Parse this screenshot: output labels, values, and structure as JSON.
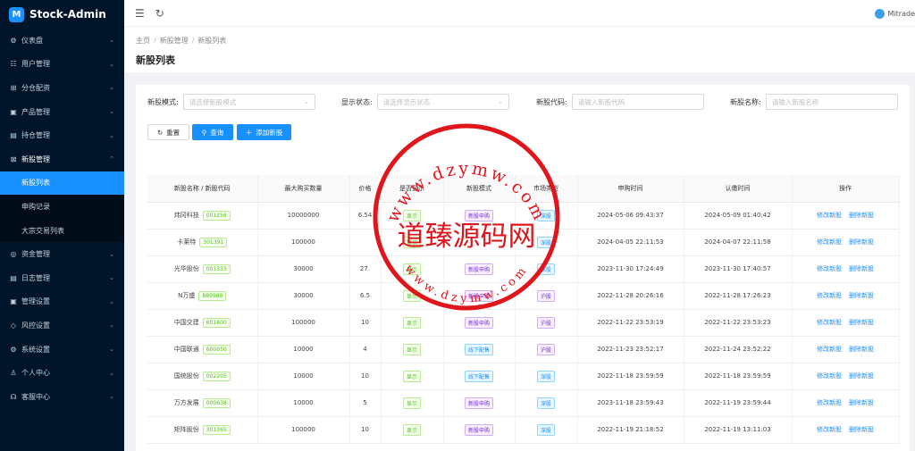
{
  "app": {
    "name": "Stock-Admin",
    "logo_glyph": "M"
  },
  "sidebar": {
    "items": [
      {
        "icon": "dashboard-icon",
        "glyph": "⚙",
        "label": "仪表盘"
      },
      {
        "icon": "user-icon",
        "glyph": "☷",
        "label": "用户管理"
      },
      {
        "icon": "split-icon",
        "glyph": "⊞",
        "label": "分仓配资"
      },
      {
        "icon": "product-icon",
        "glyph": "▣",
        "label": "产品管理"
      },
      {
        "icon": "holding-icon",
        "glyph": "▤",
        "label": "持仓管理"
      },
      {
        "icon": "ipo-icon",
        "glyph": "⊠",
        "label": "新股管理"
      }
    ],
    "sub": [
      {
        "label": "新股列表",
        "active": true
      },
      {
        "label": "申购记录"
      },
      {
        "label": "大宗交易列表"
      }
    ],
    "items2": [
      {
        "icon": "fund-icon",
        "glyph": "◎",
        "label": "资金管理"
      },
      {
        "icon": "log-icon",
        "glyph": "▤",
        "label": "日志管理"
      },
      {
        "icon": "admin-icon",
        "glyph": "▣",
        "label": "管理设置"
      },
      {
        "icon": "risk-icon",
        "glyph": "◇",
        "label": "风控设置"
      },
      {
        "icon": "settings-icon",
        "glyph": "⚙",
        "label": "系统设置"
      },
      {
        "icon": "profile-icon",
        "glyph": "♙",
        "label": "个人中心"
      },
      {
        "icon": "service-icon",
        "glyph": "☊",
        "label": "客服中心"
      }
    ]
  },
  "topbar": {
    "user": "Mitrade"
  },
  "breadcrumb": [
    "主页",
    "新股管理",
    "新股列表"
  ],
  "page_title": "新股列表",
  "filters": [
    {
      "label": "新股模式:",
      "placeholder": "请选择新股模式",
      "dropdown": true
    },
    {
      "label": "显示状态:",
      "placeholder": "请选择显示状态",
      "dropdown": true
    },
    {
      "label": "新股代码:",
      "placeholder": "请输入新股代码",
      "dropdown": false
    },
    {
      "label": "新股名称:",
      "placeholder": "请输入新股名称",
      "dropdown": false
    }
  ],
  "buttons": {
    "reset": "重置",
    "query": "查询",
    "add": "添加新股"
  },
  "table": {
    "headers": [
      "新股名称 / 新股代码",
      "最大购买数量",
      "价格",
      "是否显示",
      "新股模式",
      "市场类型",
      "申购时间",
      "认缴时间",
      "操作"
    ],
    "rows": [
      {
        "name": "炜冈科技",
        "code": "001256",
        "max": "10000000",
        "price": "6.54",
        "show": "显示",
        "mode": "新股申购",
        "market": "深股",
        "apply": "2024-05-06 09:43:37",
        "sub": "2024-05-09 01:40:42"
      },
      {
        "name": "卡莱特",
        "code": "301391",
        "max": "100000",
        "price": "",
        "show": "显示",
        "mode": "",
        "market": "深股",
        "apply": "2024-04-05 22:11:53",
        "sub": "2024-04-07 22:11:58"
      },
      {
        "name": "光华股份",
        "code": "001333",
        "max": "30000",
        "price": "27.",
        "show": "显示",
        "mode": "新股申购",
        "market": "深股",
        "apply": "2023-11-30 17:24:49",
        "sub": "2023-11-30 17:40:57"
      },
      {
        "name": "N万盛",
        "code": "889988",
        "max": "30000",
        "price": "6.5",
        "show": "显示",
        "mode": "新股申购",
        "market": "沪股",
        "apply": "2022-11-28 20:26:16",
        "sub": "2022-11-28 17:26:23"
      },
      {
        "name": "中国交建",
        "code": "601800",
        "max": "100000",
        "price": "10",
        "show": "显示",
        "mode": "新股申购",
        "market": "沪股",
        "apply": "2022-11-22 23:53:19",
        "sub": "2022-11-22 23:53:23"
      },
      {
        "name": "中国联通",
        "code": "600050",
        "max": "10000",
        "price": "4",
        "show": "显示",
        "mode": "线下配售",
        "market": "沪股",
        "apply": "2022-11-23 23:52:17",
        "sub": "2022-11-24 23:52:22"
      },
      {
        "name": "国统股份",
        "code": "002205",
        "max": "10000",
        "price": "10",
        "show": "显示",
        "mode": "线下配售",
        "market": "深股",
        "apply": "2022-11-18 23:59:59",
        "sub": "2022-11-18 23:59:59"
      },
      {
        "name": "万方发展",
        "code": "000638",
        "max": "10000",
        "price": "5",
        "show": "显示",
        "mode": "新股申购",
        "market": "深股",
        "apply": "2023-11-18 23:59:43",
        "sub": "2022-11-19 23:59:44"
      },
      {
        "name": "矩阵股份",
        "code": "301365",
        "max": "100000",
        "price": "10",
        "show": "显示",
        "mode": "新股申购",
        "market": "深股",
        "apply": "2022-11-19 21:18:52",
        "sub": "2022-11-19 13:11:03"
      }
    ],
    "actions": [
      "修改新股",
      "删除新股"
    ]
  },
  "watermark": {
    "text": "道臻源码网",
    "url_top": "www.dzymw.com",
    "url_bottom": "www.dzymw.com",
    "color": "#e0161d"
  },
  "colors": {
    "primary": "#1890ff",
    "sidebar": "#001529"
  }
}
